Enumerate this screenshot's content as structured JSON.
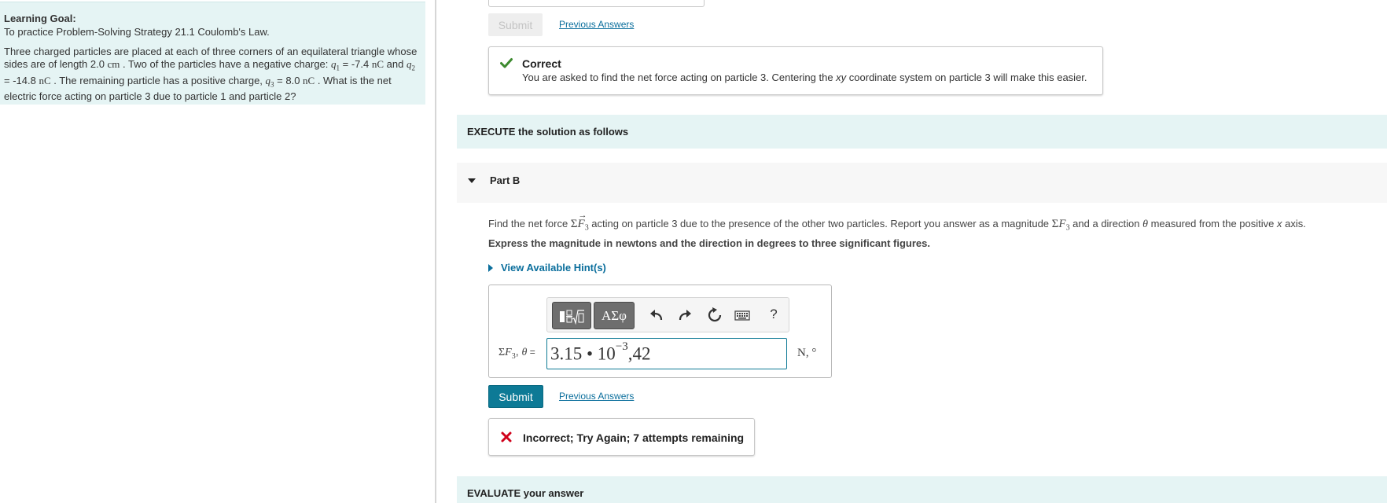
{
  "learning_goal": {
    "title": "Learning Goal:",
    "subtitle": "To practice Problem-Solving Strategy 21.1 Coulomb's Law.",
    "p1": "Three charged particles are placed at each of three corners of an equilateral triangle whose sides are of length 2.0 ",
    "unit_cm": "cm",
    "p2": " . Two of the particles have a negative charge: ",
    "q1_sym": "q",
    "q1_sub": "1",
    "q1_val": " = -7.4 ",
    "unit_nc1": "nC",
    "and": " and ",
    "q2_sym": "q",
    "q2_sub": "2",
    "q2_val": " = -14.8 ",
    "unit_nc2": "nC",
    "p3": " . The remaining particle has a positive charge, ",
    "q3_sym": "q",
    "q3_sub": "3",
    "q3_val": " = 8.0 ",
    "unit_nc3": "nC",
    "p4": " . What is the net electric force acting on particle 3 due to particle 1 and particle 2?"
  },
  "previous_part": {
    "submit_label": "Submit",
    "previous_answers_label": "Previous Answers"
  },
  "feedback_correct": {
    "title": "Correct",
    "msg_a": "You are asked to find the net force acting on particle 3. Centering the ",
    "msg_xy": "xy",
    "msg_b": " coordinate system on particle 3 will make this easier.",
    "color": "#3c8a2e"
  },
  "execute_heading": "EXECUTE the solution as follows",
  "part_b": {
    "label": "Part B",
    "q_a": "Find the net force ",
    "sigma": "Σ",
    "F": "F",
    "sub3": "3",
    "q_b": " acting on particle 3 due to the presence of the other two particles. Report you answer as a magnitude ",
    "q_c": " and a direction ",
    "theta": "θ",
    "q_d": " measured from the positive ",
    "x": "x",
    "q_e": " axis.",
    "instruction": "Express the magnitude in newtons and the direction in degrees to three significant figures.",
    "hint_label": "View Available Hint(s)"
  },
  "answer": {
    "toolbar": {
      "greek_label": "ΑΣφ",
      "help_label": "?"
    },
    "label_sigma": "Σ",
    "label_F": "F",
    "label_sub": "3",
    "label_comma": ", ",
    "label_theta": "θ",
    "label_eq": " =",
    "input_mantissa": "3.15 • 10",
    "input_exponent": "−3",
    "input_rest": ",42",
    "units": "N, °"
  },
  "submit_label": "Submit",
  "previous_answers_label": "Previous Answers",
  "feedback_incorrect": {
    "text": "Incorrect; Try Again; 7 attempts remaining",
    "color": "#d0021b"
  },
  "evaluate_heading": "EVALUATE your answer",
  "colors": {
    "accent": "#0d7a96",
    "link": "#0a6e9c",
    "panel_bg": "#e5f4f4"
  }
}
